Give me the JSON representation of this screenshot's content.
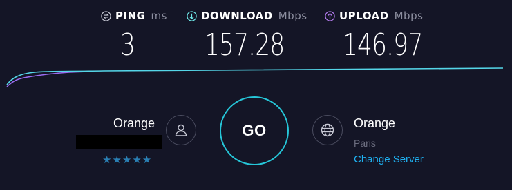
{
  "metrics": {
    "ping": {
      "label": "PING",
      "unit": "ms",
      "value": "3",
      "color": "#ffffff"
    },
    "download": {
      "label": "DOWNLOAD",
      "unit": "Mbps",
      "value": "157.28",
      "color": "#6ee6e6"
    },
    "upload": {
      "label": "UPLOAD",
      "unit": "Mbps",
      "value": "146.97",
      "color": "#b57cf0"
    }
  },
  "provider": {
    "name": "Orange",
    "rating": "★★★★★"
  },
  "go_button": {
    "label": "GO"
  },
  "server": {
    "name": "Orange",
    "location": "Paris",
    "change_label": "Change Server"
  },
  "colors": {
    "background": "#141526",
    "accent": "#26c6d8",
    "download_line": "#55d6e8",
    "upload_line": "#9a6cf0",
    "link": "#1fb0f0",
    "stars": "#2a7fb3"
  }
}
